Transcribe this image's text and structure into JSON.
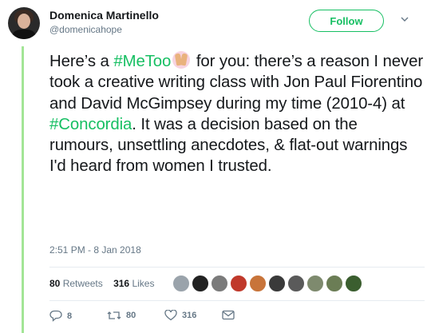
{
  "author": {
    "name": "Domenica Martinello",
    "handle": "@domenicahope"
  },
  "follow_label": "Follow",
  "tweet": {
    "part1": "Here’s a ",
    "hashtag1": "#MeToo",
    "part2": " for you: there’s a reason I never took a creative writing class with Jon Paul Fiorentino and David McGimpsey during my time (2010-4) at ",
    "hashtag2": "#Concordia",
    "part3": ". It was a decision based on the rumours, unsettling anecdotes, & flat-out warnings I'd heard from women I trusted."
  },
  "timestamp": "2:51 PM - 8 Jan 2018",
  "stats": {
    "retweets_count": "80",
    "retweets_label": "Retweets",
    "likes_count": "316",
    "likes_label": "Likes"
  },
  "liker_avatar_colors": [
    "#9aa3ab",
    "#222222",
    "#7b7b7b",
    "#c0392b",
    "#c8743a",
    "#3a3a3a",
    "#5a5a5a",
    "#7e8a6e",
    "#6b7d55",
    "#3b5e2f"
  ],
  "actions": {
    "replies": "8",
    "retweets": "80",
    "likes": "316"
  },
  "colors": {
    "accent": "#17bf63",
    "thread_bar": "#a3e596",
    "muted": "#657786"
  }
}
